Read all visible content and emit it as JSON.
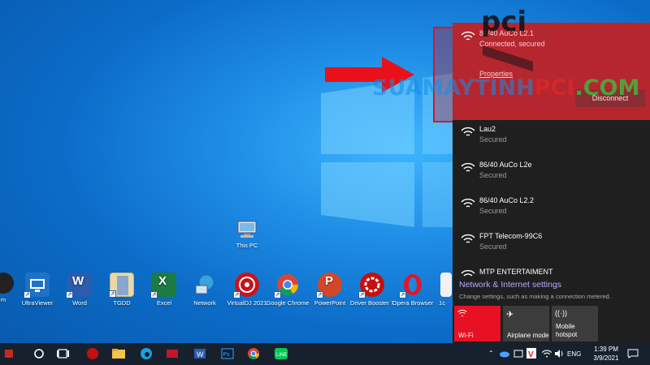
{
  "desktop": {
    "this_pc_label": "This PC",
    "icons": [
      {
        "label": "m",
        "name": "partial-app-icon"
      },
      {
        "label": "UltraViewer",
        "name": "ultraviewer-icon"
      },
      {
        "label": "Word",
        "name": "word-icon"
      },
      {
        "label": "TGDD",
        "name": "tgdd-folder-icon"
      },
      {
        "label": "Excel",
        "name": "excel-icon"
      },
      {
        "label": "Network",
        "name": "network-icon"
      },
      {
        "label": "VirtualDJ 2021",
        "name": "virtualdj-icon"
      },
      {
        "label": "Google Chrome",
        "name": "chrome-icon"
      },
      {
        "label": "PowerPoint",
        "name": "powerpoint-icon"
      },
      {
        "label": "Driver Booster 7",
        "name": "driver-booster-icon"
      },
      {
        "label": "Opera Browser",
        "name": "opera-icon"
      },
      {
        "label": "1c",
        "name": "partial-file-icon"
      }
    ]
  },
  "watermark": {
    "brand": "pci",
    "part1": "SUAMAYTINH",
    "part2": "PCI",
    "part3": ".COM"
  },
  "wifi_panel": {
    "connected": {
      "ssid": "86/40 AuCo L2.1",
      "status": "Connected, secured",
      "properties_label": "Properties",
      "disconnect_label": "Disconnect"
    },
    "networks": [
      {
        "ssid": "Lau2",
        "status": "Secured"
      },
      {
        "ssid": "86/40 AuCo L2e",
        "status": "Secured"
      },
      {
        "ssid": "86/40 AuCo L2.2",
        "status": "Secured"
      },
      {
        "ssid": "FPT Telecom-99C6",
        "status": "Secured"
      },
      {
        "ssid": "MTP ENTERTAIMENT",
        "status": ""
      }
    ],
    "settings_link": "Network & Internet settings",
    "settings_desc": "Change settings, such as making a connection metered.",
    "quick_tiles": [
      {
        "label": "Wi-Fi",
        "icon": "wifi-icon",
        "active": true
      },
      {
        "label": "Airplane mode",
        "icon": "airplane-icon",
        "active": false
      },
      {
        "label": "Mobile hotspot",
        "icon": "hotspot-icon",
        "active": false
      }
    ]
  },
  "taskbar": {
    "language": "ENG",
    "time": "1:39 PM",
    "date": "3/9/2021"
  },
  "colors": {
    "accent_red": "#e81123",
    "connected_bg": "#b6262f",
    "flyout_bg": "#1f1f1f",
    "taskbar_bg": "#17212e"
  }
}
